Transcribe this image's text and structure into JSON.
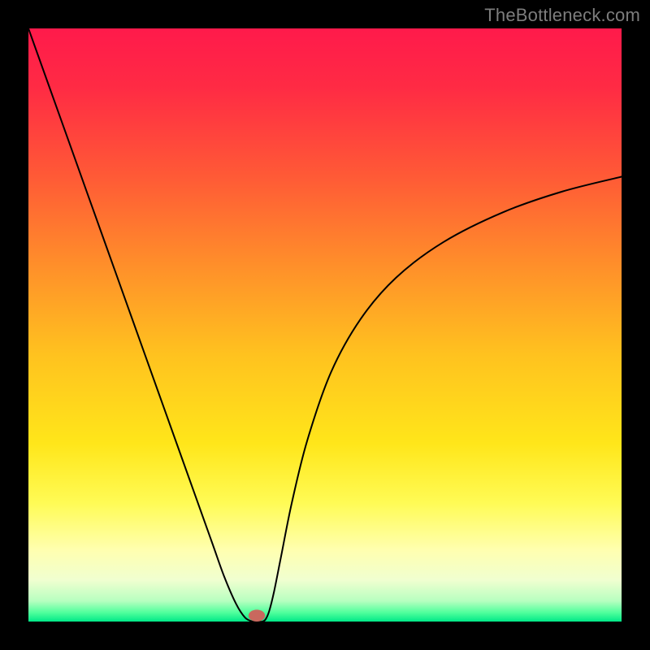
{
  "attribution": "TheBottleneck.com",
  "chart_data": {
    "type": "line",
    "title": "",
    "xlabel": "",
    "ylabel": "",
    "xlim": [
      0,
      1
    ],
    "ylim": [
      0,
      1
    ],
    "background": {
      "type": "vertical-gradient",
      "stops": [
        {
          "pos": 0.0,
          "color": "#ff1a4b"
        },
        {
          "pos": 0.1,
          "color": "#ff2b44"
        },
        {
          "pos": 0.25,
          "color": "#ff5a36"
        },
        {
          "pos": 0.4,
          "color": "#ff8f2a"
        },
        {
          "pos": 0.55,
          "color": "#ffc21f"
        },
        {
          "pos": 0.7,
          "color": "#ffe61a"
        },
        {
          "pos": 0.8,
          "color": "#fffb55"
        },
        {
          "pos": 0.88,
          "color": "#ffffb0"
        },
        {
          "pos": 0.93,
          "color": "#f0ffd0"
        },
        {
          "pos": 0.965,
          "color": "#b8ffc0"
        },
        {
          "pos": 0.985,
          "color": "#4fff9c"
        },
        {
          "pos": 1.0,
          "color": "#00e887"
        }
      ]
    },
    "series": [
      {
        "name": "bottleneck-curve",
        "color": "#000000",
        "width": 2,
        "x": [
          0.0,
          0.05,
          0.1,
          0.15,
          0.2,
          0.25,
          0.28,
          0.31,
          0.33,
          0.35,
          0.365,
          0.378,
          0.388,
          0.395,
          0.4,
          0.406,
          0.414,
          0.426,
          0.444,
          0.47,
          0.51,
          0.56,
          0.62,
          0.7,
          0.8,
          0.9,
          1.0
        ],
        "y": [
          1.0,
          0.86,
          0.72,
          0.58,
          0.44,
          0.3,
          0.216,
          0.132,
          0.076,
          0.03,
          0.007,
          0.0,
          0.0,
          0.0,
          0.004,
          0.018,
          0.05,
          0.11,
          0.2,
          0.305,
          0.42,
          0.51,
          0.58,
          0.64,
          0.69,
          0.725,
          0.75
        ]
      }
    ],
    "marker": {
      "name": "optimal-point",
      "x": 0.385,
      "y": 0.0,
      "rx": 0.014,
      "ry": 0.01,
      "color": "#c9685e"
    }
  }
}
